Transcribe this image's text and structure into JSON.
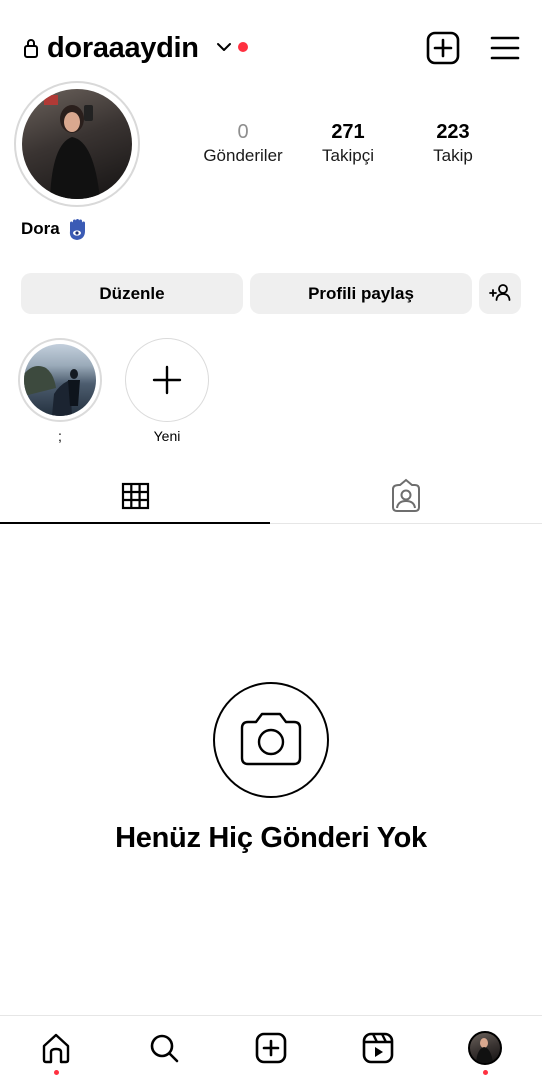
{
  "header": {
    "username": "doraaaydin",
    "icons": [
      "lock-icon",
      "chevron-down-icon",
      "plus-square-icon",
      "menu-icon"
    ],
    "notification_dot_color": "#ff3040"
  },
  "profile": {
    "display_name": "Dora",
    "bio_emoji": "hamsa-icon",
    "stats": {
      "posts": {
        "value": "0",
        "label": "Gönderiler"
      },
      "followers": {
        "value": "271",
        "label": "Takipçi"
      },
      "following": {
        "value": "223",
        "label": "Takip"
      }
    }
  },
  "buttons": {
    "edit": "Düzenle",
    "share": "Profili paylaş",
    "discover_icon": "add-person-icon"
  },
  "highlights": [
    {
      "label": ";"
    },
    {
      "label": "Yeni"
    }
  ],
  "tabs": [
    "grid-icon",
    "tagged-icon"
  ],
  "empty_state": {
    "icon": "camera-icon",
    "title": "Henüz Hiç Gönderi Yok"
  },
  "bottom_nav": [
    "home-icon",
    "search-icon",
    "create-icon",
    "reels-icon",
    "profile-avatar"
  ]
}
